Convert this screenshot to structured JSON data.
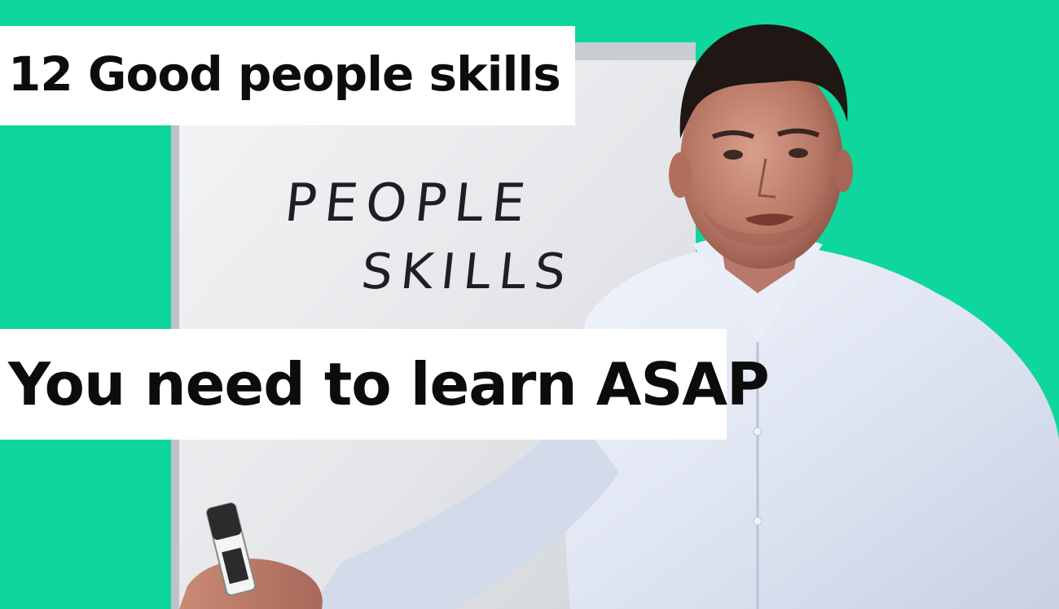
{
  "colors": {
    "background_green": "#0fd69c",
    "caption_box": "#ffffff",
    "caption_text": "#0c0c0c"
  },
  "captions": {
    "top": "12 Good people skills",
    "bottom": "You need to learn ASAP"
  },
  "flipchart": {
    "line1": "PEOPLE",
    "line2": "SKILLS"
  }
}
